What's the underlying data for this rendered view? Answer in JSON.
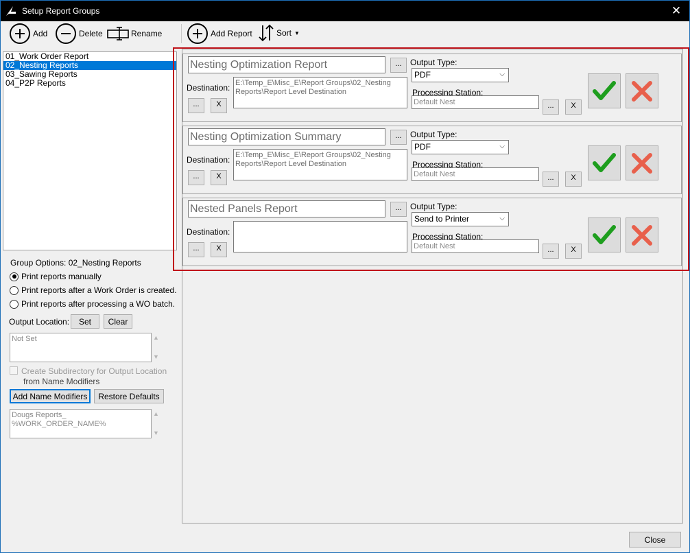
{
  "window": {
    "title": "Setup Report Groups"
  },
  "left_toolbar": {
    "add_label": "Add",
    "delete_label": "Delete",
    "rename_label": "Rename"
  },
  "right_toolbar": {
    "add_report_label": "Add Report",
    "sort_label": "Sort"
  },
  "groups": [
    {
      "label": "01_Work Order Report",
      "selected": false
    },
    {
      "label": "02_Nesting Reports",
      "selected": true
    },
    {
      "label": "03_Sawing Reports",
      "selected": false
    },
    {
      "label": "04_P2P Reports",
      "selected": false
    }
  ],
  "group_options": {
    "heading": "Group Options: 02_Nesting Reports",
    "radio_manual": "Print reports manually",
    "radio_after_wo": "Print reports after a Work Order is created.",
    "radio_after_batch": "Print reports after processing a WO batch.",
    "output_location_label": "Output Location:",
    "set_label": "Set",
    "clear_label": "Clear",
    "output_location_value": "Not Set",
    "subdir_line1": "Create Subdirectory for Output Location",
    "subdir_line2": "from Name Modifiers",
    "add_name_modifiers_label": "Add Name Modifiers",
    "restore_defaults_label": "Restore Defaults",
    "name_modifiers_line1": "Dougs Reports_",
    "name_modifiers_line2": "%WORK_ORDER_NAME%"
  },
  "labels": {
    "ellipsis": "...",
    "x": "X",
    "destination": "Destination:",
    "output_type": "Output Type:",
    "processing_station": "Processing Station:"
  },
  "reports": [
    {
      "name": "Nesting Optimization Report",
      "destination_line1": "E:\\Temp_E\\Misc_E\\Report Groups\\02_Nesting",
      "destination_line2": "Reports\\Report Level Destination",
      "output_type": "PDF",
      "station": "Default Nest"
    },
    {
      "name": "Nesting Optimization Summary",
      "destination_line1": "E:\\Temp_E\\Misc_E\\Report Groups\\02_Nesting",
      "destination_line2": "Reports\\Report Level Destination",
      "output_type": "PDF",
      "station": "Default Nest"
    },
    {
      "name": "Nested Panels Report",
      "destination_line1": "",
      "destination_line2": "",
      "output_type": "Send to Printer",
      "station": "Default Nest"
    }
  ],
  "footer": {
    "close_label": "Close"
  },
  "colors": {
    "selection": "#0078d7",
    "accept_green": "#1e9e1e",
    "reject_red": "#e8604c",
    "highlight_border": "#c0141b"
  }
}
